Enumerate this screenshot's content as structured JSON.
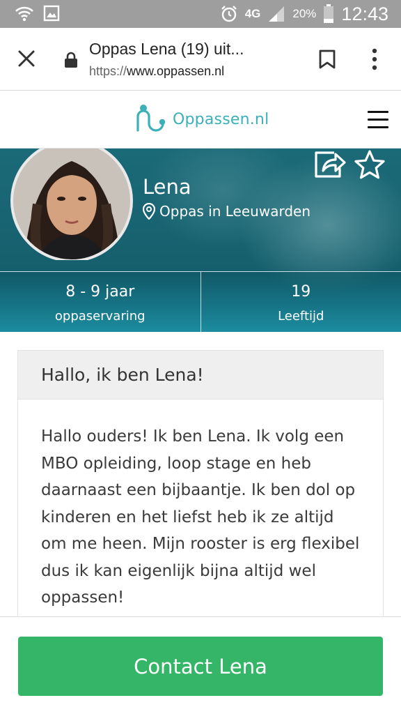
{
  "status_bar": {
    "battery_percent": "20%",
    "network_type": "4G",
    "time": "12:43",
    "icons": [
      "wifi-icon",
      "image-icon",
      "alarm-icon",
      "signal-icon",
      "battery-icon"
    ]
  },
  "browser": {
    "page_title": "Oppas Lena (19) uit...",
    "url_scheme": "https://",
    "url_domain": "www.oppassen.nl",
    "icons": [
      "close-icon",
      "lock-icon",
      "bookmark-icon",
      "overflow-menu-icon"
    ]
  },
  "site_header": {
    "logo_text": "Oppassen.nl",
    "logo_color": "#3bb0b8",
    "icons": [
      "logo-icon",
      "hamburger-menu-icon"
    ]
  },
  "profile": {
    "name": "Lena",
    "location": "Oppas in Leeuwarden",
    "icons": [
      "location-pin-icon",
      "share-icon",
      "star-icon"
    ],
    "stats": [
      {
        "value": "8 - 9 jaar",
        "label": "oppaservaring"
      },
      {
        "value": "19",
        "label": "Leeftijd"
      }
    ]
  },
  "about": {
    "title": "Hallo, ik ben Lena!",
    "body": "Hallo ouders! Ik ben Lena. Ik volg een MBO opleiding, loop stage en heb daarnaast een bijbaantje. Ik ben dol op kinderen en het liefst heb ik ze altijd om me heen. Mijn rooster is erg flexibel dus ik kan eigenlijk bijna altijd wel oppassen!"
  },
  "cta": {
    "label": "Contact Lena",
    "color": "#35b567"
  },
  "theme": {
    "hero_teal": "#17616f",
    "accent": "#3bb0b8"
  }
}
